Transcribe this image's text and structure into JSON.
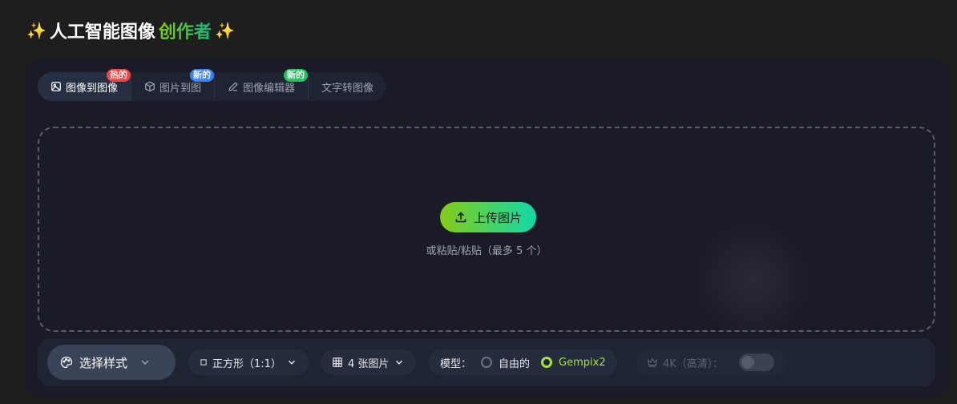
{
  "header": {
    "sparkle_left": "✨",
    "title_white": "人工智能图像",
    "title_gradient": "创作者",
    "sparkle_right": "✨"
  },
  "tabs": [
    {
      "label": "图像到图像",
      "icon": "image-icon",
      "badge": "热的",
      "badge_color": "#ef4444",
      "active": true
    },
    {
      "label": "图片到图",
      "icon": "cube-icon",
      "badge": "新的",
      "badge_color": "#3b82f6",
      "active": false
    },
    {
      "label": "图像编辑器",
      "icon": "pencil-icon",
      "badge": "新的",
      "badge_color": "#22c55e",
      "active": false
    },
    {
      "label": "文字转图像",
      "icon": "",
      "badge": "",
      "active": false
    }
  ],
  "upload": {
    "button_label": "上传图片",
    "hint": "或粘贴/粘贴（最多 5 个）"
  },
  "toolbar": {
    "style_label": "选择样式",
    "aspect_label": "正方形（1:1）",
    "count_label": "4 张图片",
    "model_label": "模型：",
    "model_options": [
      {
        "label": "自由的",
        "selected": false
      },
      {
        "label": "Gempix2",
        "selected": true
      }
    ],
    "hd_label": "4K（高清）：",
    "hd_enabled": false
  },
  "colors": {
    "accent_green": "#a3e635",
    "gradient_start": "#84cc16",
    "gradient_end": "#10d9a8"
  }
}
